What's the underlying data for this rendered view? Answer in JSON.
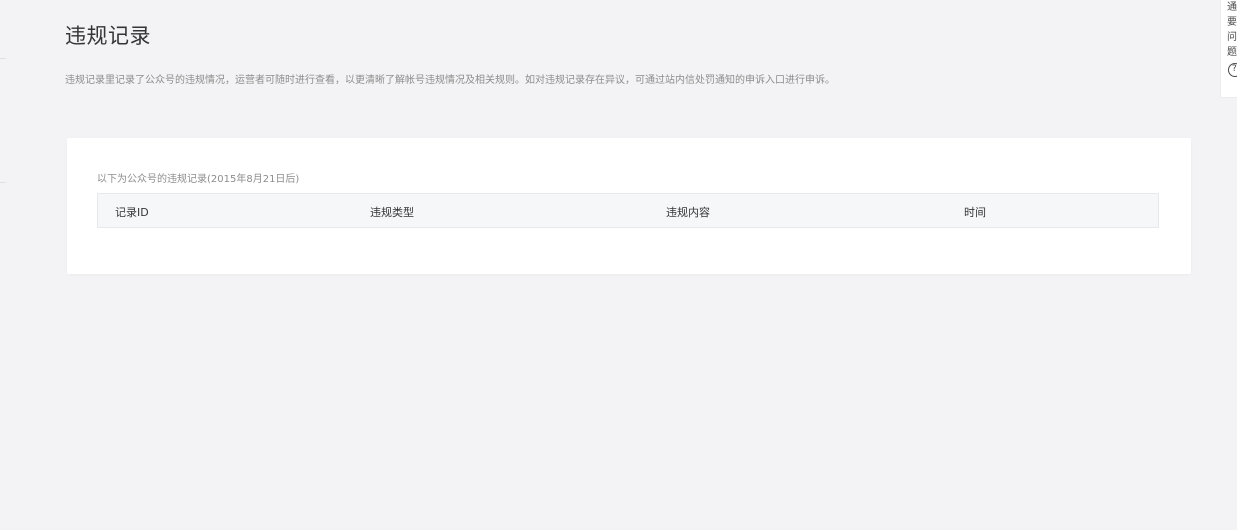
{
  "page": {
    "title": "违规记录",
    "description": "违规记录里记录了公众号的违规情况，运营者可随时进行查看，以更清晰了解帐号违规情况及相关规则。如对违规记录存在异议，可通过站内信处罚通知的申诉入口进行申诉。"
  },
  "card": {
    "caption": "以下为公众号的违规记录(2015年8月21日后)",
    "table": {
      "columns": [
        "记录ID",
        "违规类型",
        "违规内容",
        "时间"
      ],
      "rows": []
    }
  },
  "side_panel": {
    "lines": [
      "通",
      "要",
      "问",
      "题"
    ],
    "help_icon": "?"
  }
}
